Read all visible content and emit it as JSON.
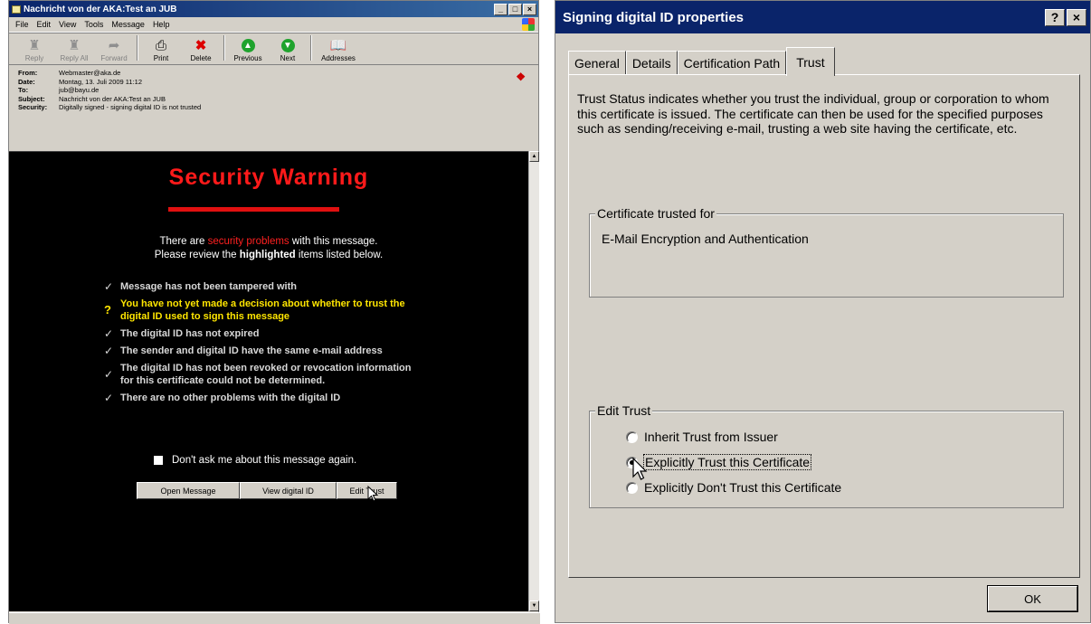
{
  "left_window": {
    "title": "Nachricht von der AKA:Test an JUB",
    "title_buttons": [
      "_",
      "□",
      "×"
    ],
    "menu": [
      "File",
      "Edit",
      "View",
      "Tools",
      "Message",
      "Help"
    ],
    "toolbar": [
      {
        "label": "Reply",
        "icon": "reply-icon",
        "enabled": false
      },
      {
        "label": "Reply All",
        "icon": "reply-all-icon",
        "enabled": false
      },
      {
        "label": "Forward",
        "icon": "forward-icon",
        "enabled": false
      },
      {
        "label": "Print",
        "icon": "print-icon",
        "enabled": true
      },
      {
        "label": "Delete",
        "icon": "delete-icon",
        "enabled": true
      },
      {
        "label": "Previous",
        "icon": "previous-icon",
        "enabled": true
      },
      {
        "label": "Next",
        "icon": "next-icon",
        "enabled": true
      },
      {
        "label": "Addresses",
        "icon": "addresses-icon",
        "enabled": true
      }
    ],
    "headers": {
      "from_label": "From:",
      "from": "Webmaster@aka.de",
      "date_label": "Date:",
      "date": "Montag, 13. Juli 2009 11:12",
      "to_label": "To:",
      "to": "jub@bayu.de",
      "subject_label": "Subject:",
      "subject": "Nachricht von der AKA:Test an JUB",
      "security_label": "Security:",
      "security": "Digitally signed - signing digital ID is not trusted"
    },
    "warning": {
      "title": "Security Warning",
      "intro_1_pre": "There are ",
      "intro_1_red": "security problems",
      "intro_1_post": " with this message.",
      "intro_2_pre": "Please review the ",
      "intro_2_bold": "highlighted",
      "intro_2_post": " items listed below.",
      "items": [
        {
          "mark": "✓",
          "text": "Message has not been tampered with",
          "warn": false
        },
        {
          "mark": "?",
          "text": "You have not yet made a decision about whether to trust the digital ID used to sign this message",
          "warn": true
        },
        {
          "mark": "✓",
          "text": "The digital ID has not expired",
          "warn": false
        },
        {
          "mark": "✓",
          "text": "The sender and digital ID have the same e-mail address",
          "warn": false
        },
        {
          "mark": "✓",
          "text": "The digital ID has not been revoked or revocation information for this certificate could not be determined.",
          "warn": false
        },
        {
          "mark": "✓",
          "text": "There are no other problems with the digital ID",
          "warn": false
        }
      ],
      "dont_ask": "Don't ask me about this message again.",
      "buttons": [
        "Open Message",
        "View digital ID",
        "Edit Trust"
      ]
    }
  },
  "right_window": {
    "title": "Signing digital ID properties",
    "title_buttons": [
      "?",
      "×"
    ],
    "tabs": [
      "General",
      "Details",
      "Certification Path",
      "Trust"
    ],
    "active_tab": "Trust",
    "description": "Trust Status indicates whether you trust the individual, group or corporation to whom this certificate is issued.  The certificate can then be used for the specified purposes such as sending/receiving e-mail, trusting a web site having the certificate, etc.",
    "trusted_for_label": "Certificate trusted for",
    "trusted_for_value": "E-Mail Encryption and Authentication",
    "edit_trust_label": "Edit Trust",
    "options": [
      {
        "label": "Inherit Trust from Issuer",
        "selected": false
      },
      {
        "label": "Explicitly Trust this Certificate",
        "selected": true
      },
      {
        "label": "Explicitly Don't Trust this Certificate",
        "selected": false
      }
    ],
    "ok_label": "OK"
  }
}
